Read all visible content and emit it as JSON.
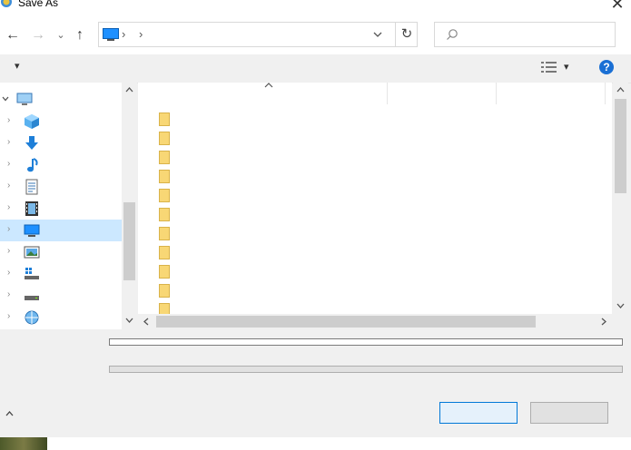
{
  "window": {
    "title": "Save As",
    "close_glyph": "✕"
  },
  "nav": {
    "back_glyph": "←",
    "forward_glyph": "→",
    "recent_glyph": "⌄",
    "up_glyph": "↑",
    "breadcrumb_sep_1": "›",
    "breadcrumb_sep_2": "›",
    "refresh_glyph": "↻"
  },
  "toolbar": {
    "organize_glyph": "▾",
    "view_dropdown_glyph": "▾",
    "help_glyph": "?"
  },
  "list": {
    "sort_glyph": "^"
  },
  "scroll": {
    "up": "^",
    "down": "v",
    "left": "<",
    "right": ">"
  },
  "bottom": {
    "hide_glyph": "^"
  },
  "icons": [
    "this-pc-icon",
    "3d-objects-icon",
    "downloads-icon",
    "music-icon",
    "documents-icon",
    "videos-icon",
    "desktop-icon",
    "pictures-icon",
    "local-disk-icon",
    "drive-icon",
    "network-icon",
    "folder-icon"
  ],
  "colors": {
    "selection": "#cce8ff",
    "accent": "#0078d7",
    "folder": "#f8d775"
  }
}
